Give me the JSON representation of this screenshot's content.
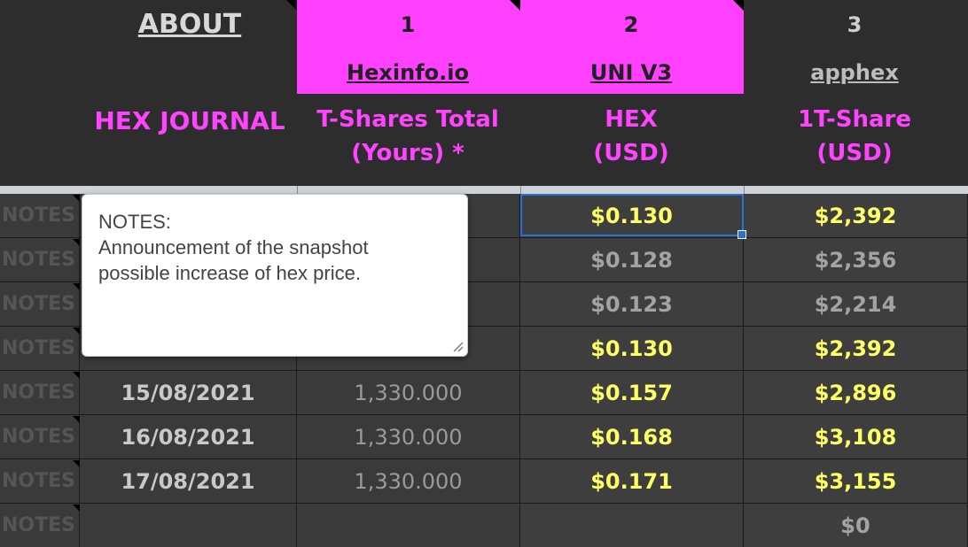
{
  "header": {
    "about": "ABOUT",
    "journal_title": "HEX JOURNAL",
    "columns": [
      {
        "number": "1",
        "source": "Hexinfo.io",
        "title_line1": "T-Shares Total",
        "title_line2": "(Yours) *"
      },
      {
        "number": "2",
        "source": "UNI V3",
        "title_line1": "HEX",
        "title_line2": "(USD)"
      },
      {
        "number": "3",
        "source": "apphex",
        "title_line1": "1T-Share",
        "title_line2": "(USD)"
      }
    ]
  },
  "rows": [
    {
      "notes": "NOTES",
      "date": "",
      "tshares": "",
      "hex": "$0.130",
      "share": "$2,392",
      "dim": false
    },
    {
      "notes": "NOTES",
      "date": "",
      "tshares": "",
      "hex": "$0.128",
      "share": "$2,356",
      "dim": true
    },
    {
      "notes": "NOTES",
      "date": "",
      "tshares": "",
      "hex": "$0.123",
      "share": "$2,214",
      "dim": true
    },
    {
      "notes": "NOTES",
      "date": "",
      "tshares": "",
      "hex": "$0.130",
      "share": "$2,392",
      "dim": false
    },
    {
      "notes": "NOTES",
      "date": "15/08/2021",
      "tshares": "1,330.000",
      "hex": "$0.157",
      "share": "$2,896",
      "dim": false
    },
    {
      "notes": "NOTES",
      "date": "16/08/2021",
      "tshares": "1,330.000",
      "hex": "$0.168",
      "share": "$3,108",
      "dim": false
    },
    {
      "notes": "NOTES",
      "date": "17/08/2021",
      "tshares": "1,330.000",
      "hex": "$0.171",
      "share": "$3,155",
      "dim": false
    },
    {
      "notes": "NOTES",
      "date": "",
      "tshares": "",
      "hex": "",
      "share": "$0",
      "dim": true
    }
  ],
  "note_popup": {
    "line1": "NOTES:",
    "line2": "Announcement of the snapshot",
    "line3": "possible increase of hex price."
  },
  "colors": {
    "magenta": "#ff40ff",
    "yellow_value": "#ffff66",
    "selection": "#2a6fdb"
  }
}
